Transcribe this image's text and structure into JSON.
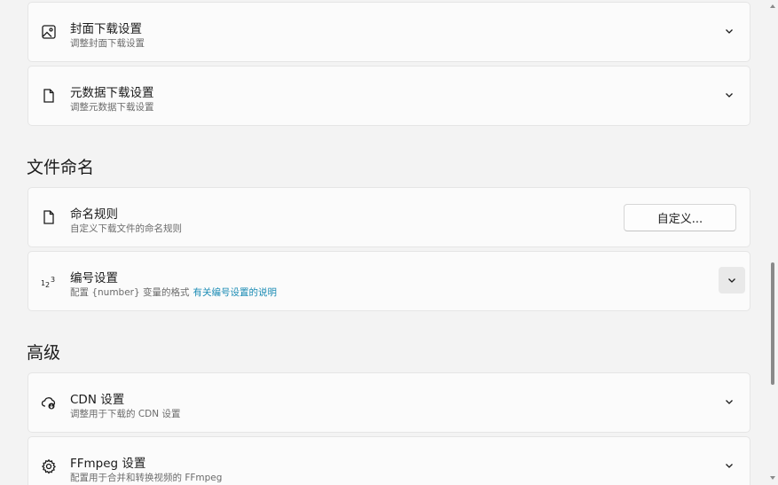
{
  "sections": {
    "file_naming": {
      "heading": "文件命名"
    },
    "advanced": {
      "heading": "高级"
    }
  },
  "cards": {
    "cover": {
      "icon": "image-icon",
      "title": "封面下载设置",
      "desc": "调整封面下载设置"
    },
    "metadata": {
      "icon": "document-icon",
      "title": "元数据下载设置",
      "desc": "调整元数据下载设置"
    },
    "naming_rule": {
      "icon": "document-icon",
      "title": "命名规则",
      "desc": "自定义下载文件的命名规则",
      "button_label": "自定义..."
    },
    "numbering": {
      "icon": "numbers-icon",
      "title": "编号设置",
      "desc": "配置 {number} 变量的格式",
      "link": "有关编号设置的说明"
    },
    "cdn": {
      "icon": "cloud-download-icon",
      "title": "CDN 设置",
      "desc": "调整用于下载的 CDN 设置"
    },
    "ffmpeg": {
      "icon": "gear-icon",
      "title": "FFmpeg 设置",
      "desc": "配置用于合并和转换视频的 FFmpeg"
    }
  },
  "colors": {
    "background": "#f3f3f3",
    "card": "#fbfbfb",
    "link": "#1a8bb4"
  }
}
